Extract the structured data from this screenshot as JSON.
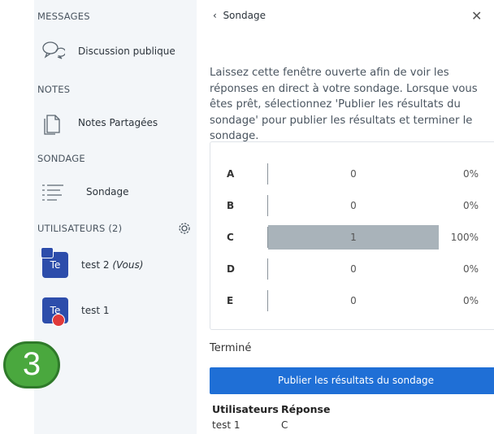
{
  "sidebar": {
    "messages_title": "MESSAGES",
    "messages_item": "Discussion publique",
    "notes_title": "NOTES",
    "notes_item": "Notes Partagées",
    "poll_title": "SONDAGE",
    "poll_item": "Sondage",
    "users_title": "UTILISATEURS (2)",
    "users": [
      {
        "initials": "Te",
        "name": "test 2",
        "suffix": "(Vous)"
      },
      {
        "initials": "Te",
        "name": "test 1",
        "suffix": ""
      }
    ]
  },
  "step_badge": "3",
  "panel": {
    "back_label": "Sondage",
    "close_symbol": "✕",
    "description": "Laissez cette fenêtre ouverte afin de voir les réponses en direct à votre sondage. Lorsque vous êtes prêt, sélectionnez 'Publier les résultats du sondage' pour publier les résultats et terminer le sondage.",
    "results": [
      {
        "letter": "A",
        "count": "0",
        "percent": "0%",
        "fraction": 0
      },
      {
        "letter": "B",
        "count": "0",
        "percent": "0%",
        "fraction": 0
      },
      {
        "letter": "C",
        "count": "1",
        "percent": "100%",
        "fraction": 1
      },
      {
        "letter": "D",
        "count": "0",
        "percent": "0%",
        "fraction": 0
      },
      {
        "letter": "E",
        "count": "0",
        "percent": "0%",
        "fraction": 0
      }
    ],
    "status": "Terminé",
    "publish_label": "Publier les résultats du sondage",
    "responses": {
      "headers": [
        "Utilisateurs",
        "Réponse"
      ],
      "rows": [
        [
          "test 1",
          "C"
        ]
      ]
    }
  },
  "colors": {
    "sidebar_bg": "#f3f6f9",
    "accent_blue": "#1f6fd6",
    "avatar_blue": "#2d4dab",
    "bar_gray": "#a9b3ba",
    "badge_green": "#4aa83e"
  }
}
